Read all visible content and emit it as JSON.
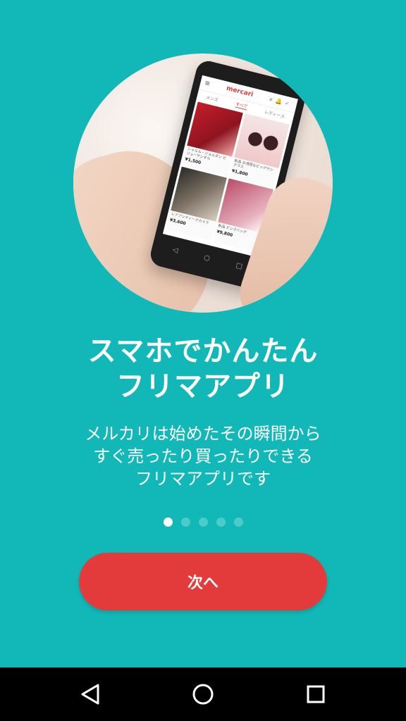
{
  "hero": {
    "app_logo_text": "mercari",
    "tabs": [
      "メンズ",
      "すべて",
      "レディース"
    ],
    "items": [
      {
        "caption": "シャルル・ジョルダン ビジューサンダル",
        "price": "¥1,500",
        "image": "red-shoes"
      },
      {
        "caption": "新品 お洒落なビッグサングラス",
        "price": "¥1,800",
        "image": "sunglasses"
      },
      {
        "caption": "レアアンティークカメラ",
        "price": "¥3,600",
        "image": "camera"
      },
      {
        "caption": "新品 ピンクバッグ",
        "price": "¥9,800",
        "image": "bag"
      }
    ]
  },
  "headline": {
    "line1": "スマホでかんたん",
    "line2": "フリマアプリ"
  },
  "subtitle": {
    "line1": "メルカリは始めたその瞬間から",
    "line2": "すぐ売ったり買ったりできる",
    "line3": "フリマアプリです"
  },
  "pager": {
    "count": 5,
    "active_index": 0
  },
  "next_button": {
    "label": "次へ"
  },
  "colors": {
    "background": "#12b8b8",
    "button": "#e33b3b",
    "text": "#ffffff"
  },
  "system_nav": {
    "icons": [
      "back-icon",
      "home-icon",
      "recent-apps-icon"
    ]
  }
}
